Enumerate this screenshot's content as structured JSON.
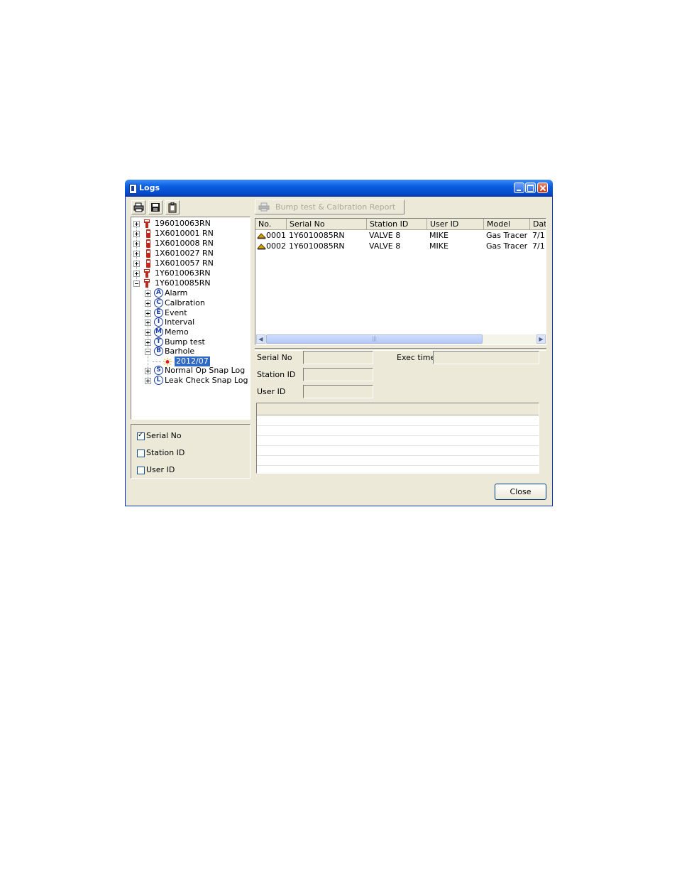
{
  "window": {
    "title": "Logs"
  },
  "toolbar": {
    "report_button_label": "Bump test & Calbration Report"
  },
  "tree": {
    "devices": [
      "196010063RN",
      "1X6010001 RN",
      "1X6010008 RN",
      "1X6010027 RN",
      "1X6010057 RN",
      "1Y6010063RN",
      "1Y6010085RN"
    ],
    "categories": [
      {
        "letter": "A",
        "label": "Alarm"
      },
      {
        "letter": "C",
        "label": "Calbration"
      },
      {
        "letter": "E",
        "label": "Event"
      },
      {
        "letter": "I",
        "label": "Interval"
      },
      {
        "letter": "M",
        "label": "Memo"
      },
      {
        "letter": "T",
        "label": "Bump test"
      },
      {
        "letter": "B",
        "label": "Barhole"
      }
    ],
    "selected_leaf": "2012/07",
    "extra_categories": [
      {
        "letter": "S",
        "label": "Normal Op Snap Log"
      },
      {
        "letter": "L",
        "label": "Leak Check Snap Log"
      }
    ]
  },
  "filter": {
    "options": [
      {
        "label": "Serial No",
        "checked": true
      },
      {
        "label": "Station ID",
        "checked": false
      },
      {
        "label": "User ID",
        "checked": false
      }
    ]
  },
  "list": {
    "columns": [
      "No.",
      "Serial No",
      "Station ID",
      "User ID",
      "Model",
      "Date"
    ],
    "rows": [
      [
        "0001",
        "1Y6010085RN",
        "VALVE 8",
        "MIKE",
        "Gas Tracer",
        "7/1"
      ],
      [
        "0002",
        "1Y6010085RN",
        "VALVE 8",
        "MIKE",
        "Gas Tracer",
        "7/1"
      ]
    ]
  },
  "details": {
    "serial_label": "Serial No",
    "exec_time_label": "Exec time",
    "station_label": "Station ID",
    "user_label": "User ID"
  },
  "footer": {
    "close_label": "Close"
  }
}
